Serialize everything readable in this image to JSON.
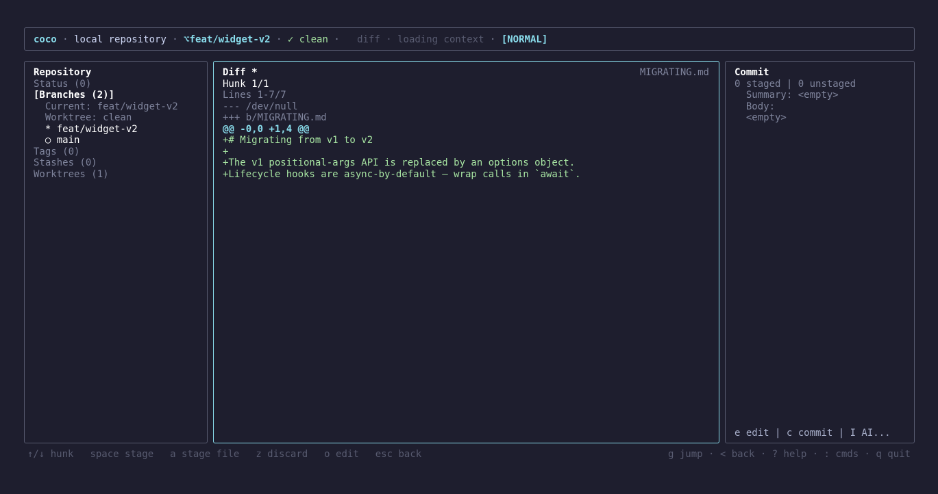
{
  "header": {
    "app": "coco",
    "sep1": " · ",
    "repo": "local repository",
    "sep2": " · ",
    "branch": "⌥feat/widget-v2",
    "sep3": " · ",
    "status": "✓ clean",
    "sep4": " ·   ",
    "view": "diff",
    "sep5": " · ",
    "context": "loading context",
    "sep6": " · ",
    "mode": "[NORMAL]"
  },
  "repository": {
    "title": "Repository",
    "status": "Status (0)",
    "branches": "[Branches (2)]",
    "current": "  Current: feat/widget-v2",
    "worktree": "  Worktree: clean",
    "branch_items": [
      "  * feat/widget-v2",
      "  ○ main"
    ],
    "tags": "Tags (0)",
    "stashes": "Stashes (0)",
    "worktrees": "Worktrees (1)"
  },
  "diff": {
    "title": "Diff *",
    "filename": "MIGRATING.md",
    "hunk": "Hunk 1/1",
    "lines": "Lines 1-7/7",
    "minus_file": "--- /dev/null",
    "plus_file": "+++ b/MIGRATING.md",
    "hunk_header": "@@ -0,0 +1,4 @@",
    "added_lines": [
      "+# Migrating from v1 to v2",
      "+",
      "+The v1 positional-args API is replaced by an options object.",
      "+Lifecycle hooks are async-by-default — wrap calls in `await`."
    ]
  },
  "commit": {
    "title": "Commit",
    "counts": "0 staged | 0 unstaged",
    "summary": "  Summary: <empty>",
    "body_label": "  Body:",
    "body_value": "  <empty>",
    "actions": "e edit | c commit | I AI..."
  },
  "footer": {
    "left": [
      "↑/↓ hunk",
      "space stage",
      "a stage file",
      "z discard",
      "o edit",
      "esc back"
    ],
    "right": "g jump · < back · ? help · : cmds · q quit"
  }
}
